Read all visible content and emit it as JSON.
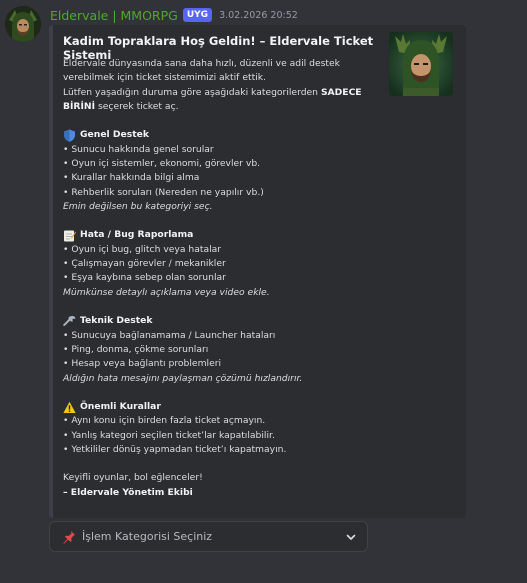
{
  "message": {
    "username": "Eldervale | MMORPG",
    "badge": "UYG",
    "timestamp": "3.02.2026 20:52"
  },
  "embed": {
    "title": "Kadim Topraklara Hoş Geldin! – Eldervale Ticket Sistemi",
    "intro": [
      "Eldervale dünyasında sana daha hızlı, düzenli ve adil destek",
      "verebilmek için ticket sistemimizi aktif ettik."
    ],
    "instruction_prefix": "Lütfen yaşadığın duruma göre aşağıdaki kategorilerden ",
    "instruction_bold_1": "SADECE",
    "instruction_bold_2": "BİRİNİ",
    "instruction_suffix": " seçerek ticket aç.",
    "sections": [
      {
        "icon": "shield-icon",
        "title": "Genel Destek",
        "items": [
          "• Sunucu hakkında genel sorular",
          "• Oyun içi sistemler, ekonomi, görevler vb.",
          "• Kurallar hakkında bilgi alma",
          "• Rehberlik soruları (Nereden ne yapılır vb.)"
        ],
        "note": "Emin değilsen bu kategoriyi seç."
      },
      {
        "icon": "memo-icon",
        "title": "Hata / Bug Raporlama",
        "items": [
          "• Oyun içi bug, glitch veya hatalar",
          "• Çalışmayan görevler / mekanikler",
          "• Eşya kaybına sebep olan sorunlar"
        ],
        "note": "Mümkünse detaylı açıklama veya video ekle."
      },
      {
        "icon": "wrench-icon",
        "title": "Teknik Destek",
        "items": [
          "• Sunucuya bağlanamama / Launcher hataları",
          "• Ping, donma, çökme sorunları",
          "• Hesap veya bağlantı problemleri"
        ],
        "note": "Aldığın hata mesajını paylaşman çözümü hızlandırır."
      },
      {
        "icon": "warning-icon",
        "title": "Önemli Kurallar",
        "items": [
          "• Aynı konu için birden fazla ticket açmayın.",
          "• Yanlış kategori seçilen ticket’lar kapatılabilir.",
          "• Yetkililer dönüş yapmadan ticket’ı kapatmayın."
        ],
        "note": ""
      }
    ],
    "closing": "Keyifli oyunlar, bol eğlenceler!",
    "signature": "– Eldervale Yönetim Ekibi"
  },
  "select_menu": {
    "icon": "pushpin-icon",
    "placeholder": "İşlem Kategorisi Seçiniz"
  },
  "colors": {
    "background": "#323339",
    "embed_bg": "#2b2d31",
    "username": "#4fa82b",
    "badge": "#5865f2"
  }
}
